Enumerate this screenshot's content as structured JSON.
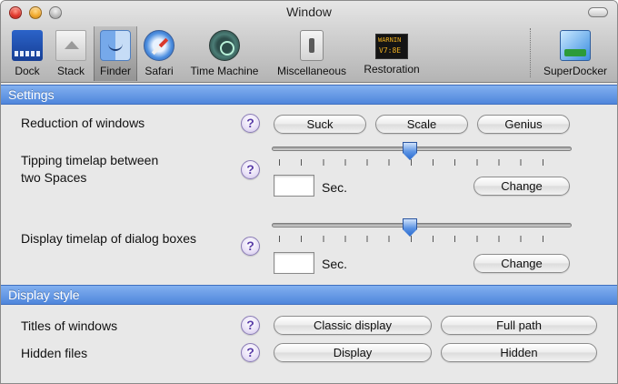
{
  "window": {
    "title": "Window"
  },
  "toolbar": {
    "items": [
      {
        "label": "Dock",
        "icon": "dock-icon"
      },
      {
        "label": "Stack",
        "icon": "stack-icon"
      },
      {
        "label": "Finder",
        "icon": "finder-icon",
        "selected": true
      },
      {
        "label": "Safari",
        "icon": "safari-icon"
      },
      {
        "label": "Time Machine",
        "icon": "time-machine-icon"
      },
      {
        "label": "Miscellaneous",
        "icon": "switch-icon"
      },
      {
        "label": "Restoration",
        "icon": "warning-display-icon"
      },
      {
        "label": "SuperDocker",
        "icon": "superdocker-icon"
      }
    ]
  },
  "settings": {
    "header": "Settings",
    "reduction": {
      "label": "Reduction of windows",
      "help": "?",
      "buttons": [
        "Suck",
        "Scale",
        "Genius"
      ]
    },
    "tipping": {
      "label_line1": "Tipping timelap between",
      "label_line2": "two Spaces",
      "help": "?",
      "slider_value_fraction": 0.46,
      "field_value": "",
      "unit": "Sec.",
      "change_label": "Change"
    },
    "dialog": {
      "label": "Display timelap of dialog boxes",
      "help": "?",
      "slider_value_fraction": 0.46,
      "field_value": "",
      "unit": "Sec.",
      "change_label": "Change"
    }
  },
  "display_style": {
    "header": "Display style",
    "titles": {
      "label": "Titles of windows",
      "help": "?",
      "buttons": [
        "Classic display",
        "Full path"
      ]
    },
    "hidden": {
      "label": "Hidden files",
      "help": "?",
      "buttons": [
        "Display",
        "Hidden"
      ]
    }
  },
  "colors": {
    "section_header": "#5f93e2",
    "knob": "#3f7fd8",
    "help_icon": "#5a3da8"
  }
}
